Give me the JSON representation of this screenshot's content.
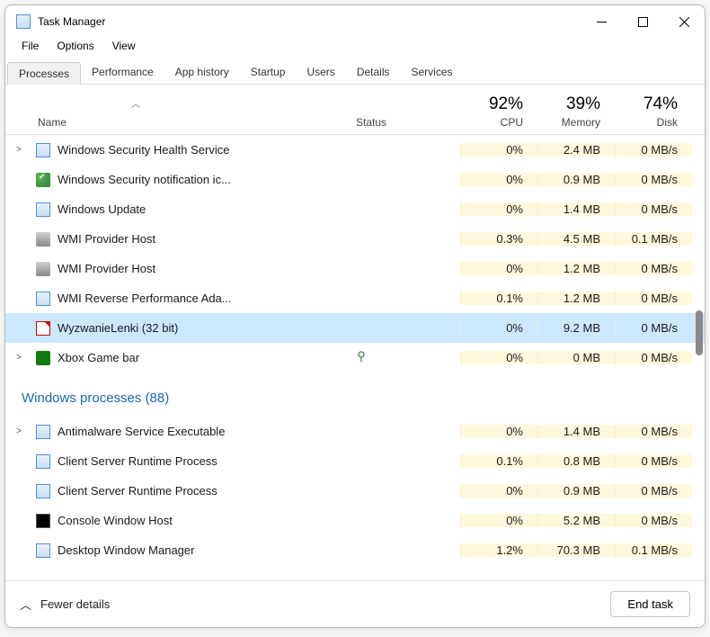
{
  "titlebar": {
    "title": "Task Manager"
  },
  "menubar": [
    "File",
    "Options",
    "View"
  ],
  "tabs": [
    {
      "label": "Processes",
      "active": true
    },
    {
      "label": "Performance",
      "active": false
    },
    {
      "label": "App history",
      "active": false
    },
    {
      "label": "Startup",
      "active": false
    },
    {
      "label": "Users",
      "active": false
    },
    {
      "label": "Details",
      "active": false
    },
    {
      "label": "Services",
      "active": false
    }
  ],
  "headers": {
    "name": "Name",
    "status": "Status",
    "cpu_pct": "92%",
    "cpu": "CPU",
    "mem_pct": "39%",
    "mem": "Memory",
    "disk_pct": "74%",
    "disk": "Disk"
  },
  "group_label": "Windows processes (88)",
  "processes": [
    {
      "expand": true,
      "icon": "ic-generic",
      "name": "Windows Security Health Service",
      "leaf": false,
      "cpu": "0%",
      "mem": "2.4 MB",
      "disk": "0 MB/s",
      "selected": false
    },
    {
      "expand": false,
      "icon": "ic-shield",
      "name": "Windows Security notification ic...",
      "leaf": false,
      "cpu": "0%",
      "mem": "0.9 MB",
      "disk": "0 MB/s",
      "selected": false
    },
    {
      "expand": false,
      "icon": "ic-update",
      "name": "Windows Update",
      "leaf": false,
      "cpu": "0%",
      "mem": "1.4 MB",
      "disk": "0 MB/s",
      "selected": false
    },
    {
      "expand": false,
      "icon": "ic-wmi",
      "name": "WMI Provider Host",
      "leaf": false,
      "cpu": "0.3%",
      "mem": "4.5 MB",
      "disk": "0.1 MB/s",
      "selected": false
    },
    {
      "expand": false,
      "icon": "ic-wmi",
      "name": "WMI Provider Host",
      "leaf": false,
      "cpu": "0%",
      "mem": "1.2 MB",
      "disk": "0 MB/s",
      "selected": false
    },
    {
      "expand": false,
      "icon": "ic-generic",
      "name": "WMI Reverse Performance Ada...",
      "leaf": false,
      "cpu": "0.1%",
      "mem": "1.2 MB",
      "disk": "0 MB/s",
      "selected": false
    },
    {
      "expand": false,
      "icon": "ic-pdf",
      "name": "WyzwanieLenki (32 bit)",
      "leaf": false,
      "cpu": "0%",
      "mem": "9.2 MB",
      "disk": "0 MB/s",
      "selected": true
    },
    {
      "expand": true,
      "icon": "ic-xbox",
      "name": "Xbox Game bar",
      "leaf": true,
      "cpu": "0%",
      "mem": "0 MB",
      "disk": "0 MB/s",
      "selected": false
    }
  ],
  "win_processes": [
    {
      "expand": true,
      "icon": "ic-generic",
      "name": "Antimalware Service Executable",
      "leaf": false,
      "cpu": "0%",
      "mem": "1.4 MB",
      "disk": "0 MB/s"
    },
    {
      "expand": false,
      "icon": "ic-generic",
      "name": "Client Server Runtime Process",
      "leaf": false,
      "cpu": "0.1%",
      "mem": "0.8 MB",
      "disk": "0 MB/s"
    },
    {
      "expand": false,
      "icon": "ic-generic",
      "name": "Client Server Runtime Process",
      "leaf": false,
      "cpu": "0%",
      "mem": "0.9 MB",
      "disk": "0 MB/s"
    },
    {
      "expand": false,
      "icon": "ic-console",
      "name": "Console Window Host",
      "leaf": false,
      "cpu": "0%",
      "mem": "5.2 MB",
      "disk": "0 MB/s"
    },
    {
      "expand": false,
      "icon": "ic-generic",
      "name": "Desktop Window Manager",
      "leaf": false,
      "cpu": "1.2%",
      "mem": "70.3 MB",
      "disk": "0.1 MB/s"
    }
  ],
  "footer": {
    "fewer": "Fewer details",
    "end_task": "End task"
  }
}
